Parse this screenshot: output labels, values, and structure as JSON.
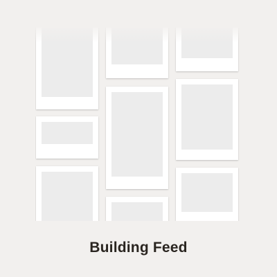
{
  "status": {
    "title": "Building Feed"
  },
  "feed": {
    "column_count": 3,
    "cards": [
      {
        "column": 1,
        "orientation": "portrait"
      },
      {
        "column": 1,
        "orientation": "landscape"
      },
      {
        "column": 1,
        "orientation": "portrait"
      },
      {
        "column": 2,
        "orientation": "landscape"
      },
      {
        "column": 2,
        "orientation": "portrait"
      },
      {
        "column": 2,
        "orientation": "landscape"
      },
      {
        "column": 3,
        "orientation": "landscape"
      },
      {
        "column": 3,
        "orientation": "portrait"
      },
      {
        "column": 3,
        "orientation": "landscape"
      }
    ]
  },
  "colors": {
    "background": "#f2f0ee",
    "card": "#ffffff",
    "photo_placeholder": "#ececec",
    "title_text": "#2a2520"
  }
}
